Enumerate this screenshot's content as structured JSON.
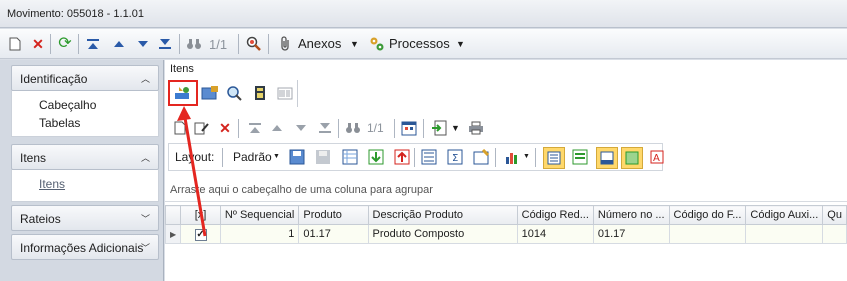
{
  "window": {
    "title": "Movimento: 055018 - 1.1.01"
  },
  "main_toolbar": {
    "record_position": "1/1",
    "anexos_label": "Anexos",
    "processos_label": "Processos"
  },
  "sidebar": {
    "sections": [
      {
        "label": "Identificação",
        "items": [
          "Cabeçalho",
          "Tabelas"
        ]
      },
      {
        "label": "Itens",
        "items": [
          "Itens"
        ]
      },
      {
        "label": "Rateios",
        "items": []
      },
      {
        "label": "Informações Adicionais",
        "items": []
      }
    ]
  },
  "itens_panel": {
    "group_title": "Itens",
    "record_position": "1/1",
    "layout_label": "Layout:",
    "layout_value": "Padrão",
    "group_hint": "Arraste aqui o cabeçalho de uma coluna para agrupar"
  },
  "grid": {
    "columns": [
      "[x]",
      "Nº Sequencial",
      "Produto",
      "Descrição Produto",
      "Código Red...",
      "Número no ...",
      "Código do F...",
      "Código Auxi...",
      "Qu"
    ],
    "rows": [
      {
        "checked": true,
        "seq": "1",
        "produto": "01.17",
        "descricao": "Produto Composto",
        "codigo_red": "1014",
        "numero": "01.17",
        "codigo_f": "",
        "codigo_aux": "",
        "qu": ""
      }
    ]
  },
  "colors": {
    "highlight": "#e42620",
    "accent": "#2b5797"
  },
  "icons": [
    "new-document-icon",
    "delete-icon",
    "refresh-icon",
    "first-record-icon",
    "previous-record-icon",
    "next-record-icon",
    "last-record-icon",
    "binoculars-icon",
    "zoom-icon",
    "paperclip-icon",
    "processes-icon",
    "edit-icon",
    "calendar-icon",
    "import-icon",
    "print-icon",
    "calculator-icon",
    "chart-icon"
  ]
}
